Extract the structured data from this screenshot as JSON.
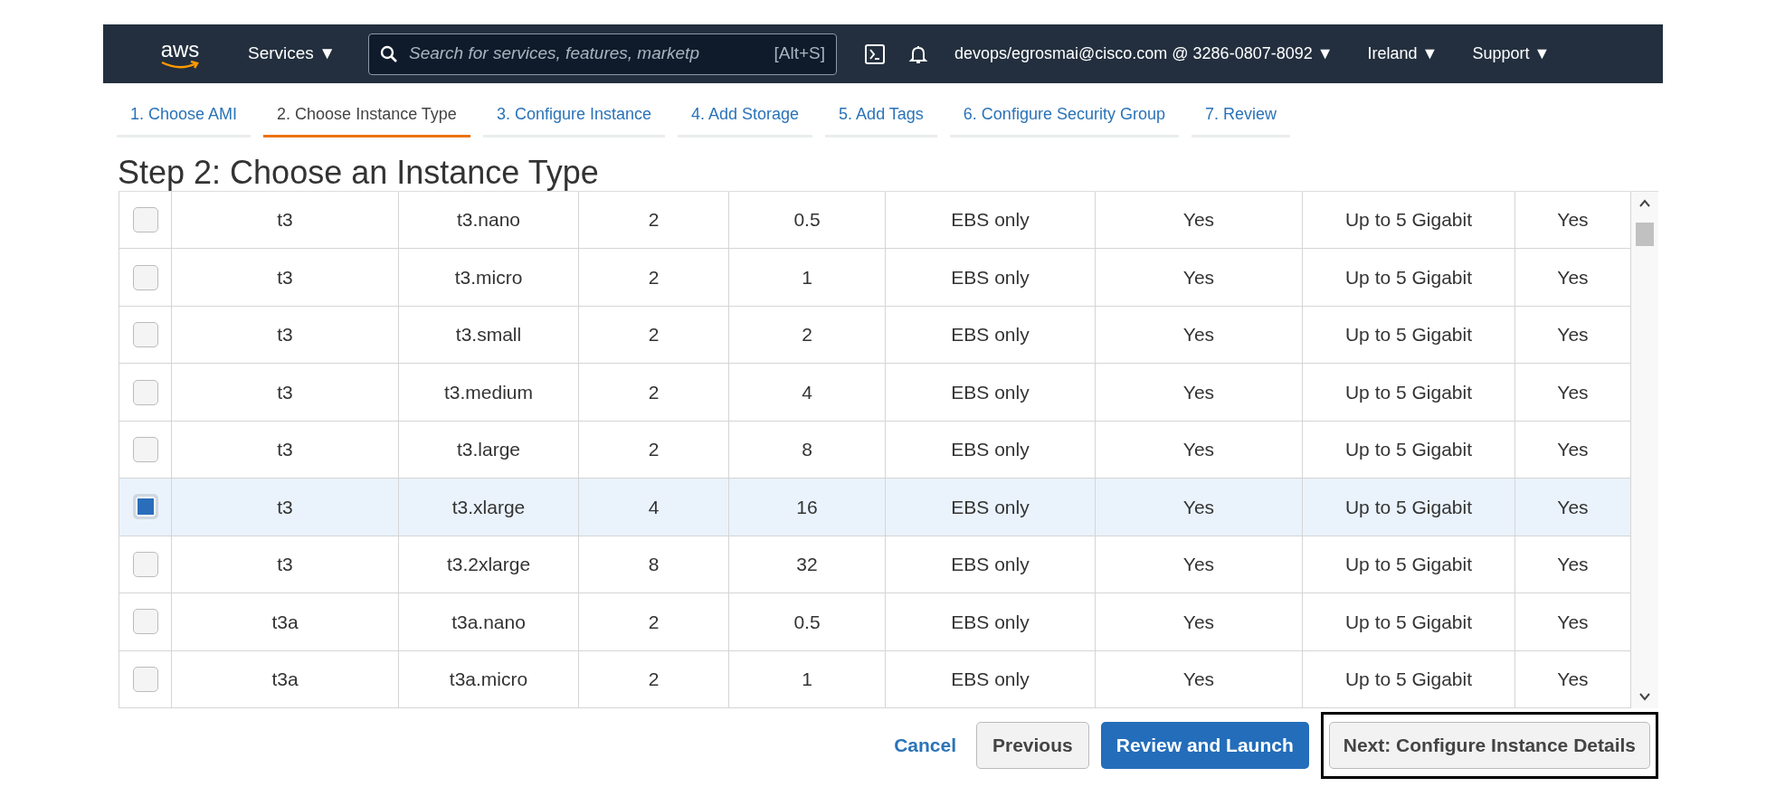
{
  "navbar": {
    "logo": "aws",
    "services": "Services ▼",
    "search": {
      "placeholder": "Search for services, features, marketp",
      "shortcut": "[Alt+S]"
    },
    "account": "devops/egrosmai@cisco.com @ 3286-0807-8092 ▼",
    "region": "Ireland ▼",
    "support": "Support ▼"
  },
  "steps": [
    {
      "label": "1. Choose AMI",
      "selected": false
    },
    {
      "label": "2. Choose Instance Type",
      "selected": true
    },
    {
      "label": "3. Configure Instance",
      "selected": false
    },
    {
      "label": "4. Add Storage",
      "selected": false
    },
    {
      "label": "5. Add Tags",
      "selected": false
    },
    {
      "label": "6. Configure Security Group",
      "selected": false
    },
    {
      "label": "7. Review",
      "selected": false
    }
  ],
  "heading": "Step 2: Choose an Instance Type",
  "rows": [
    {
      "checked": false,
      "cells": [
        "t3",
        "t3.nano",
        "2",
        "0.5",
        "EBS only",
        "Yes",
        "Up to 5 Gigabit",
        "Yes"
      ]
    },
    {
      "checked": false,
      "cells": [
        "t3",
        "t3.micro",
        "2",
        "1",
        "EBS only",
        "Yes",
        "Up to 5 Gigabit",
        "Yes"
      ]
    },
    {
      "checked": false,
      "cells": [
        "t3",
        "t3.small",
        "2",
        "2",
        "EBS only",
        "Yes",
        "Up to 5 Gigabit",
        "Yes"
      ]
    },
    {
      "checked": false,
      "cells": [
        "t3",
        "t3.medium",
        "2",
        "4",
        "EBS only",
        "Yes",
        "Up to 5 Gigabit",
        "Yes"
      ]
    },
    {
      "checked": false,
      "cells": [
        "t3",
        "t3.large",
        "2",
        "8",
        "EBS only",
        "Yes",
        "Up to 5 Gigabit",
        "Yes"
      ]
    },
    {
      "checked": true,
      "cells": [
        "t3",
        "t3.xlarge",
        "4",
        "16",
        "EBS only",
        "Yes",
        "Up to 5 Gigabit",
        "Yes"
      ]
    },
    {
      "checked": false,
      "cells": [
        "t3",
        "t3.2xlarge",
        "8",
        "32",
        "EBS only",
        "Yes",
        "Up to 5 Gigabit",
        "Yes"
      ]
    },
    {
      "checked": false,
      "cells": [
        "t3a",
        "t3a.nano",
        "2",
        "0.5",
        "EBS only",
        "Yes",
        "Up to 5 Gigabit",
        "Yes"
      ]
    },
    {
      "checked": false,
      "cells": [
        "t3a",
        "t3a.micro",
        "2",
        "1",
        "EBS only",
        "Yes",
        "Up to 5 Gigabit",
        "Yes"
      ]
    }
  ],
  "footer": {
    "cancel": "Cancel",
    "previous": "Previous",
    "review": "Review and Launch",
    "next": "Next: Configure Instance Details"
  }
}
